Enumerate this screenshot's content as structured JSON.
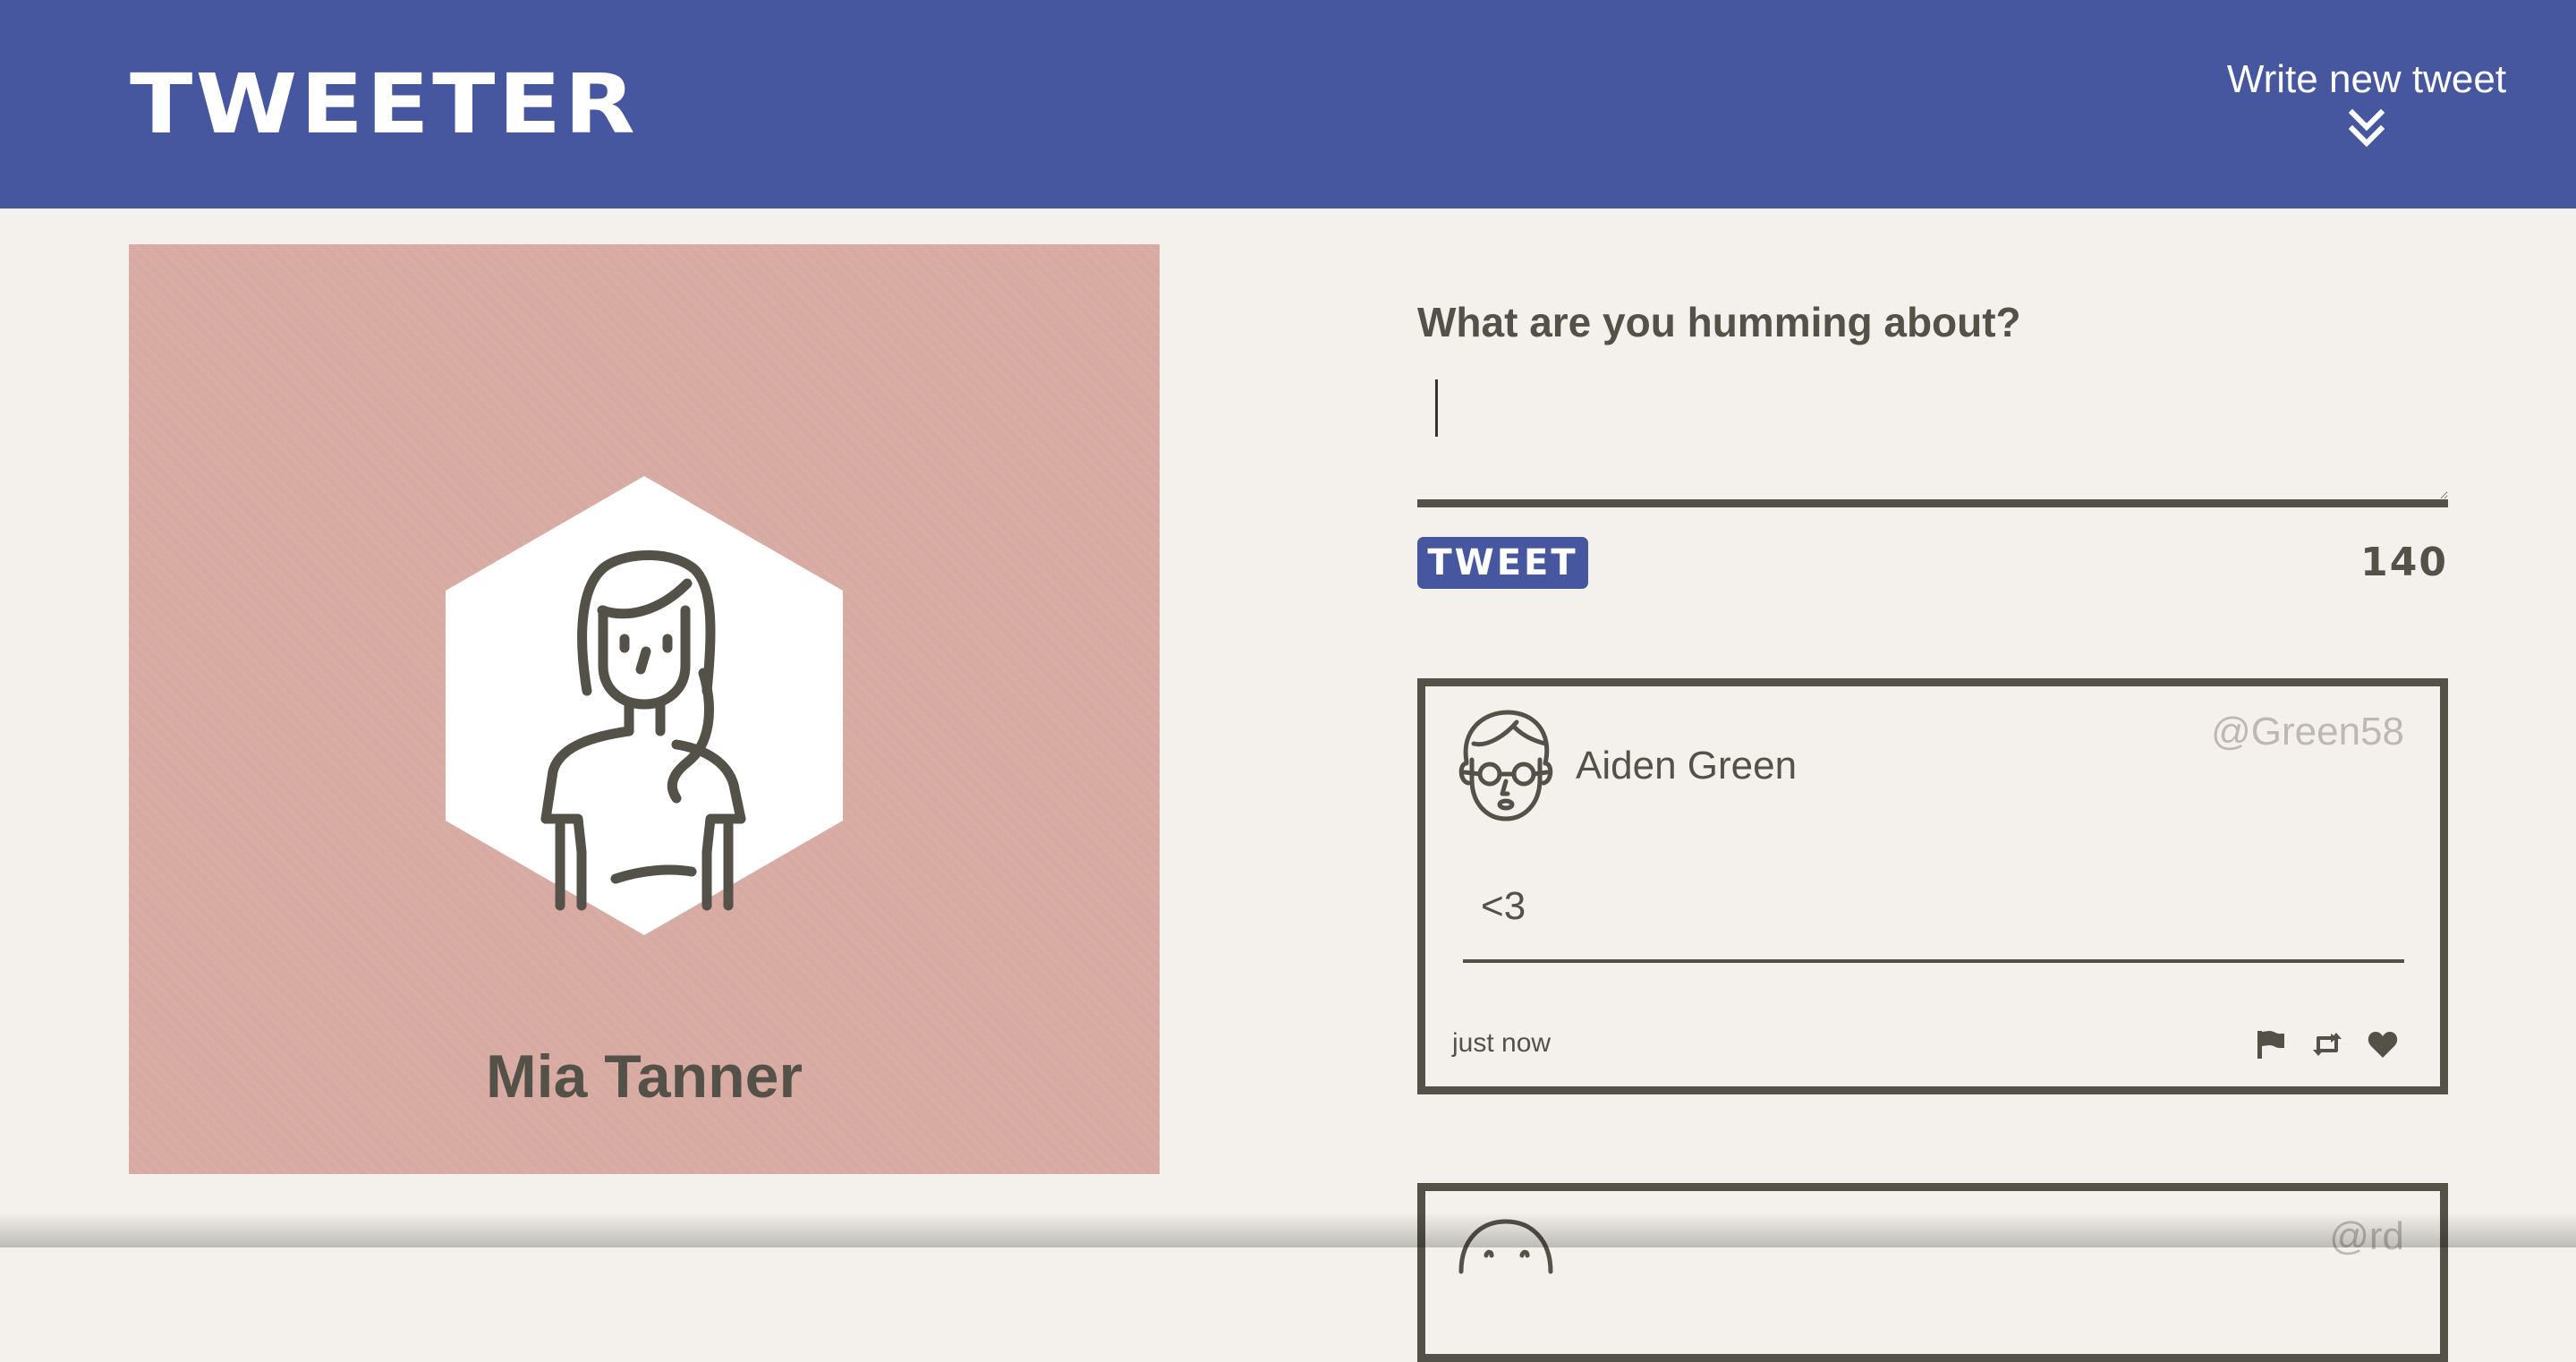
{
  "nav": {
    "brand": "TWEETER",
    "compose_toggle_label": "Write new tweet",
    "compose_toggle_icon": "double-chevron-down-icon"
  },
  "profile": {
    "name": "Mia Tanner",
    "avatar": "woman-avatar-icon",
    "card_color": "#d7aaa2"
  },
  "compose": {
    "label": "What are you humming about?",
    "textarea_value": "",
    "button_label": "TWEET",
    "counter": "140"
  },
  "tweets": [
    {
      "name": "Aiden Green",
      "handle": "@Green58",
      "avatar": "man-with-glasses-avatar-icon",
      "content": "<3",
      "time": "just now",
      "actions": [
        "flag-icon",
        "retweet-icon",
        "heart-icon"
      ]
    },
    {
      "name": "",
      "handle": "@rd",
      "avatar": "avatar-icon",
      "content": "",
      "time": ""
    }
  ],
  "colors": {
    "brand_blue": "#4657a0",
    "background": "#f4f1ec",
    "text": "#545149",
    "handle": "#bdb9b2"
  }
}
